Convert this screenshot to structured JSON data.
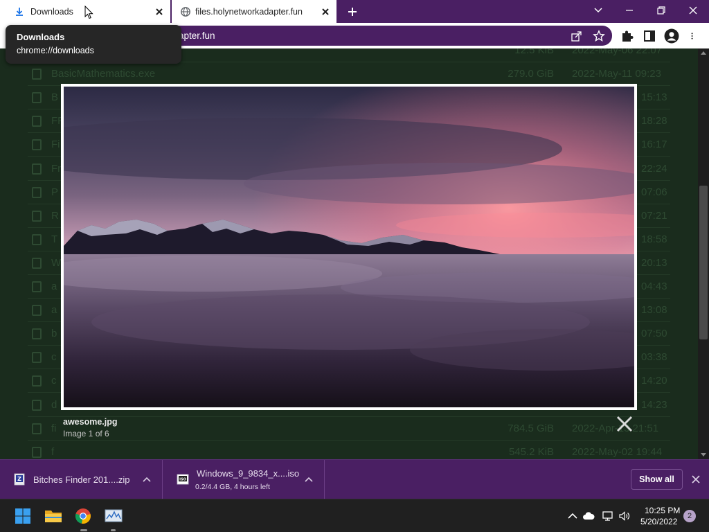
{
  "colors": {
    "accent": "#4a1f63",
    "page_background": "#1a2c1d",
    "taskbar": "#202020"
  },
  "tabs": [
    {
      "title": "Downloads",
      "icon": "download-icon",
      "active": false
    },
    {
      "title": "files.holynetworkadapter.fun",
      "icon": "globe-icon",
      "active": true
    }
  ],
  "omnibox": {
    "url_visible": "apter.fun"
  },
  "tooltip": {
    "title": "Downloads",
    "url": "chrome://downloads"
  },
  "file_list": {
    "rows": [
      {
        "name": "",
        "size": "12.5 KiB",
        "date": "2022-May-06 22:07"
      },
      {
        "name": "BasicMathematics.exe",
        "size": "279.0 GiB",
        "date": "2022-May-11 09:23"
      },
      {
        "name": "B",
        "size": "",
        "date": "15:13"
      },
      {
        "name": "FF",
        "size": "",
        "date": "18:28"
      },
      {
        "name": "Fi",
        "size": "",
        "date": "16:17"
      },
      {
        "name": "Fr",
        "size": "",
        "date": "22:24"
      },
      {
        "name": "P",
        "size": "",
        "date": "07:06"
      },
      {
        "name": "R",
        "size": "",
        "date": "07:21"
      },
      {
        "name": "T",
        "size": "",
        "date": "18:58"
      },
      {
        "name": "W",
        "size": "",
        "date": "20:13"
      },
      {
        "name": "a",
        "size": "",
        "date": "04:43"
      },
      {
        "name": "a",
        "size": "",
        "date": "13:08"
      },
      {
        "name": "b",
        "size": "",
        "date": "07:50"
      },
      {
        "name": "c",
        "size": "",
        "date": "03:38"
      },
      {
        "name": "c",
        "size": "",
        "date": "14:20"
      },
      {
        "name": "d",
        "size": "",
        "date": "14:23"
      },
      {
        "name": "fi",
        "size": "784.5 GiB",
        "date": "2022-Apr-13 21:51"
      },
      {
        "name": "f",
        "size": "545.2 KiB",
        "date": "2022-May-02 19:44"
      }
    ]
  },
  "lightbox": {
    "filename": "awesome.jpg",
    "counter": "Image 1 of 6"
  },
  "download_shelf": {
    "items": [
      {
        "name": "Bitches Finder 201....zip",
        "status": "",
        "icon": "zip-file-icon"
      },
      {
        "name": "Windows_9_9834_x....iso",
        "status": "0.2/4.4 GB, 4 hours left",
        "icon": "iso-file-icon"
      }
    ],
    "show_all_label": "Show all"
  },
  "taskbar": {
    "apps": [
      "start-icon",
      "file-explorer-icon",
      "chrome-icon",
      "resource-monitor-icon"
    ],
    "clock_time": "10:25 PM",
    "clock_date": "5/20/2022",
    "notification_count": "2"
  }
}
